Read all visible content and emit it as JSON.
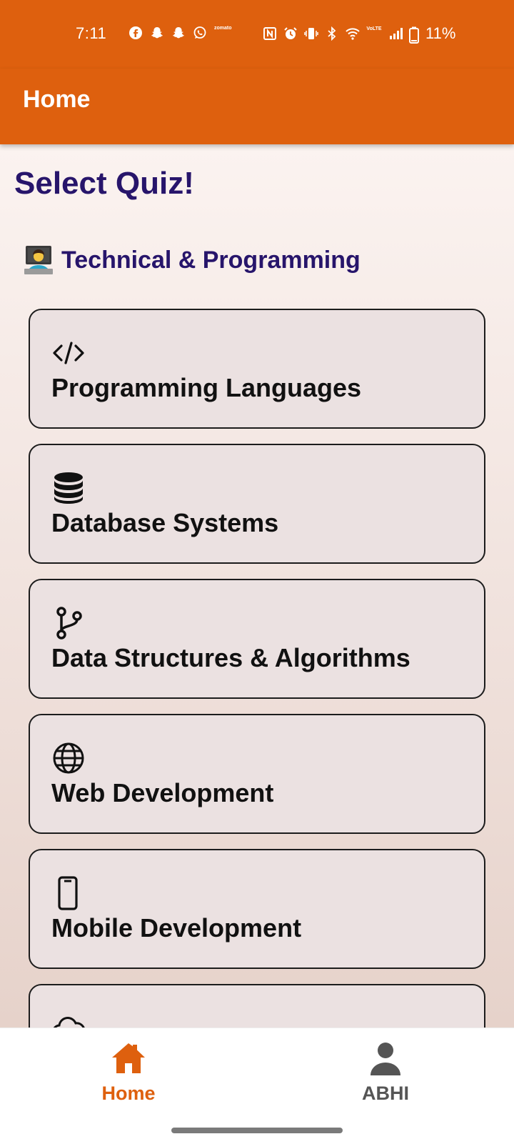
{
  "status_bar": {
    "time": "7:11",
    "battery": "11%",
    "network_label": "VoLTE",
    "app_label": "zomato",
    "left_icons": [
      "facebook-icon",
      "snapchat-icon",
      "snapchat-icon",
      "whatsapp-icon",
      "zomato-icon"
    ],
    "right_icons": [
      "nfc-icon",
      "alarm-icon",
      "vibrate-icon",
      "bluetooth-icon",
      "wifi-icon",
      "volte-icon",
      "signal-icon",
      "battery-icon"
    ]
  },
  "app_bar": {
    "title": "Home"
  },
  "main": {
    "page_title": "Select Quiz!",
    "section": {
      "emoji": "technologist-emoji",
      "title": "Technical & Programming"
    },
    "quizzes": [
      {
        "icon": "code-icon",
        "label": "Programming Languages"
      },
      {
        "icon": "database-icon",
        "label": "Database Systems"
      },
      {
        "icon": "git-branch-icon",
        "label": "Data Structures & Algorithms"
      },
      {
        "icon": "globe-icon",
        "label": "Web Development"
      },
      {
        "icon": "smartphone-icon",
        "label": "Mobile Development"
      },
      {
        "icon": "cloud-icon",
        "label": ""
      }
    ]
  },
  "bottom_nav": {
    "items": [
      {
        "icon": "home-icon",
        "label": "Home",
        "active": true
      },
      {
        "icon": "person-icon",
        "label": "ABHI",
        "active": false
      }
    ]
  },
  "colors": {
    "brand": "#DE600E",
    "title_text": "#27156b",
    "card_bg": "#ebe1e1"
  }
}
